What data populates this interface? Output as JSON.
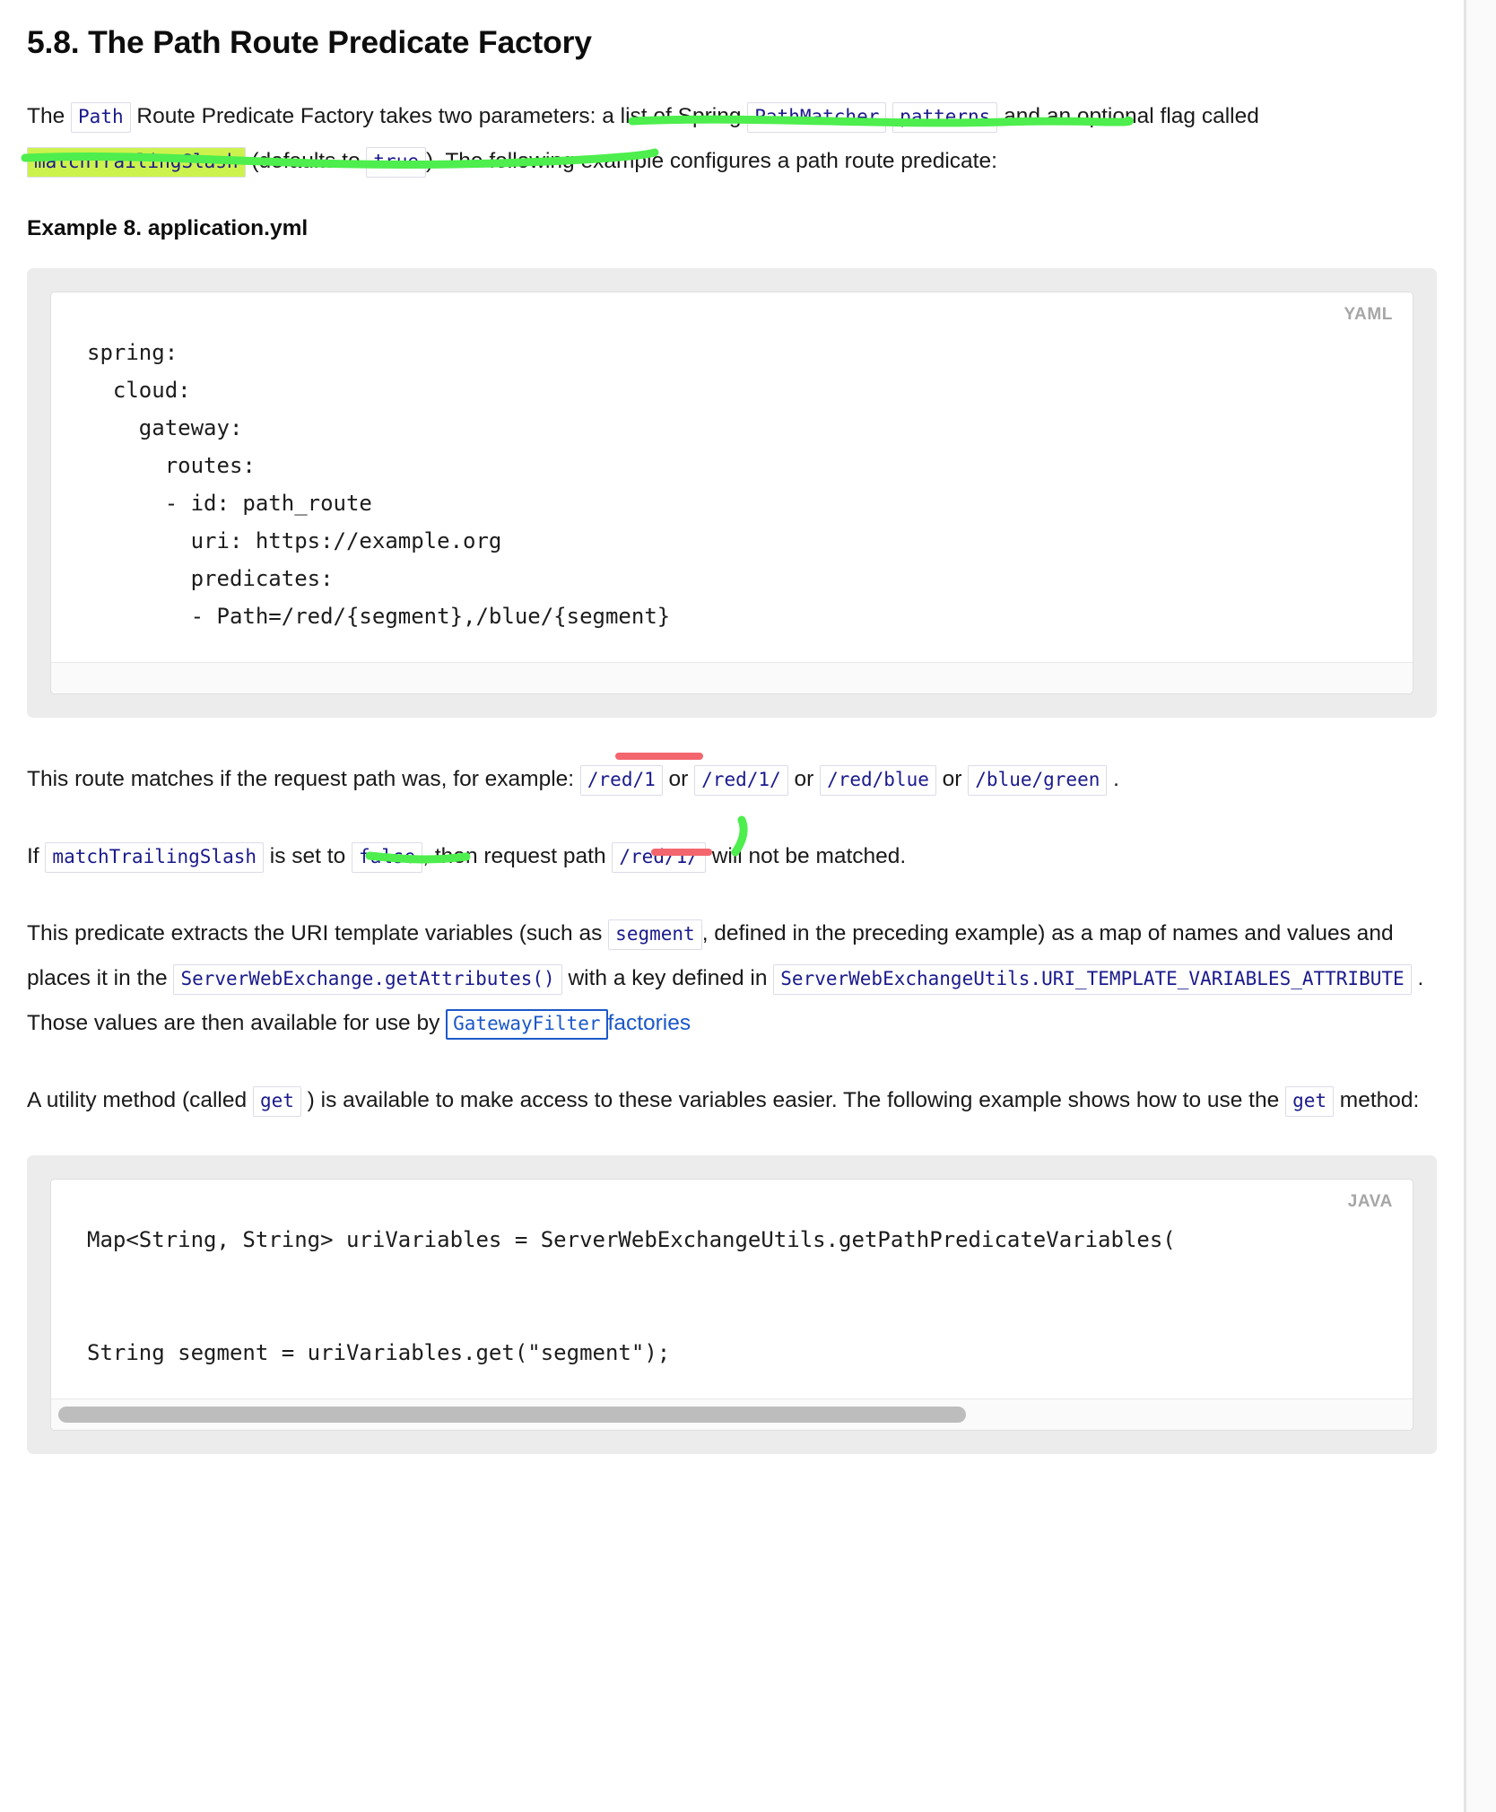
{
  "document": {
    "section_number": "5.8.",
    "heading": "5.8. The Path Route Predicate Factory"
  },
  "paragraphs": {
    "intro": {
      "t1": "The ",
      "c1": "Path",
      "t2": " Route Predicate Factory takes two parameters: a list of Spring ",
      "c2": "PathMatcher",
      "t3": " ",
      "c3": "patterns",
      "t4": " and an optional flag called ",
      "c4": "matchTrailingSlash",
      "t5": " (defaults to ",
      "c5": "true",
      "t6": "). The following example configures a path route predicate:"
    },
    "matches": {
      "t1": "This route matches if the request path was, for example: ",
      "c1": "/red/1",
      "t2": " or ",
      "c2": "/red/1/",
      "t3": " or ",
      "c3": "/red/blue",
      "t4": " or ",
      "c4": "/blue/green",
      "t5": " ."
    },
    "trailing": {
      "t1": "If ",
      "c1": "matchTrailingSlash",
      "t2": " is set to ",
      "c2": "false",
      "t3": ", then request path ",
      "c3": "/red/1/",
      "t4": " will not be matched."
    },
    "extract": {
      "t1": "This predicate extracts the URI template variables (such as ",
      "c1": "segment",
      "t2": ", defined in the preceding example) as a map of names and values and places it in the ",
      "c2": "ServerWebExchange.getAttributes()",
      "t3": " with a key defined in ",
      "c3": "ServerWebExchangeUtils.URI_TEMPLATE_VARIABLES_ATTRIBUTE",
      "t4": " . Those values are then available for use by ",
      "c4": "GatewayFilter",
      "link": "factories"
    },
    "utility": {
      "t1": "A utility method (called ",
      "c1": "get",
      "t2": " ) is available to make access to these variables easier. The following example shows how to use the ",
      "c2": "get",
      "t3": " method:"
    }
  },
  "examples": {
    "yaml": {
      "caption": "Example 8. application.yml",
      "lang_label": "YAML",
      "code": "spring:\n  cloud:\n    gateway:\n      routes:\n      - id: path_route\n        uri: https://example.org\n        predicates:\n        - Path=/red/{segment},/blue/{segment}"
    },
    "java": {
      "lang_label": "JAVA",
      "code": "Map<String, String> uriVariables = ServerWebExchangeUtils.getPathPredicateVariables(\n\n\nString segment = uriVariables.get(\"segment\");"
    }
  },
  "annotations": {
    "highlight_color": "#ccf24d",
    "green_ink": "#4dee4d",
    "red_ink": "#f4666e",
    "items": [
      {
        "name": "green-underline-patterns",
        "shape": "underline",
        "color": "#4dee4d"
      },
      {
        "name": "green-underline-matchtrailingslash",
        "shape": "underline",
        "color": "#4dee4d"
      },
      {
        "name": "red-underline-red-1",
        "shape": "underline",
        "color": "#f4666e"
      },
      {
        "name": "green-underline-false",
        "shape": "underline",
        "color": "#4dee4d"
      },
      {
        "name": "red-underline-red-1-slash",
        "shape": "underline",
        "color": "#f4666e"
      },
      {
        "name": "green-stroke-trailing-slash",
        "shape": "stroke",
        "color": "#4dee4d"
      }
    ]
  }
}
